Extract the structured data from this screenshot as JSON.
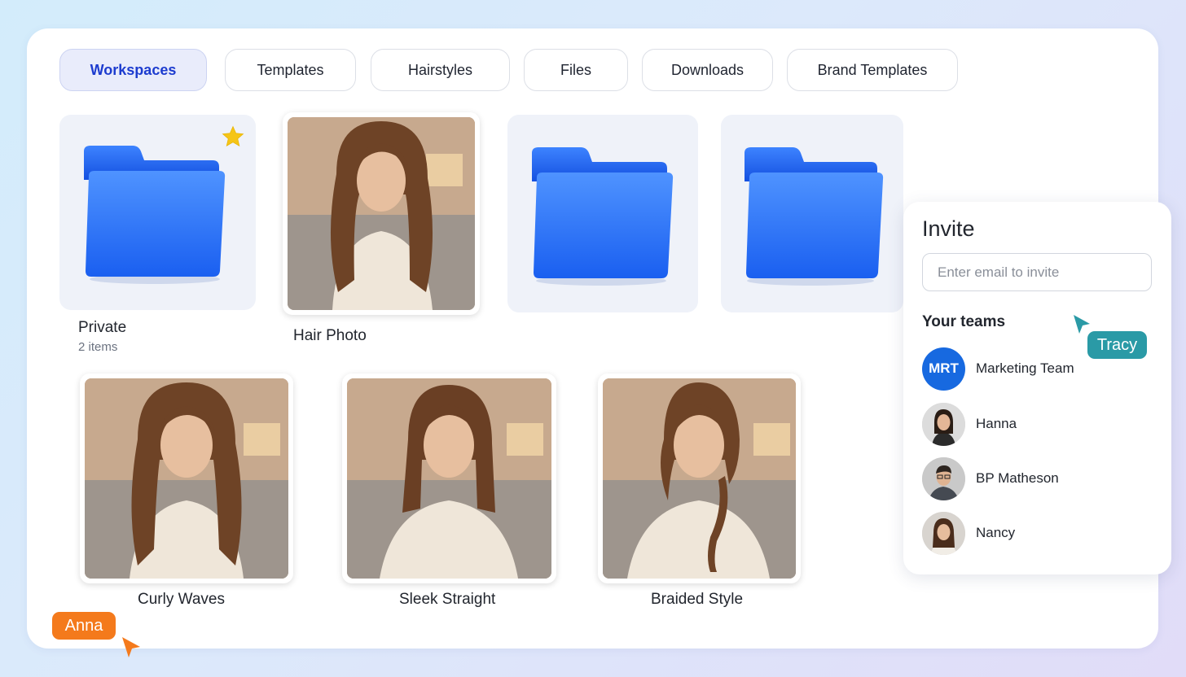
{
  "tabs": [
    {
      "label": "Workspaces",
      "active": true
    },
    {
      "label": "Templates",
      "active": false
    },
    {
      "label": "Hairstyles",
      "active": false
    },
    {
      "label": "Files",
      "active": false
    },
    {
      "label": "Downloads",
      "active": false
    },
    {
      "label": "Brand Templates",
      "active": false
    }
  ],
  "items": {
    "private": {
      "name": "Private",
      "count": "2 items",
      "icon": "folder-icon",
      "starred": true
    },
    "hair_photo": {
      "name": "Hair Photo"
    },
    "folder_2": {
      "icon": "folder-icon"
    },
    "folder_3": {
      "icon": "folder-icon"
    },
    "curly": {
      "name": "Curly Waves"
    },
    "sleek": {
      "name": "Sleek Straight"
    },
    "braided": {
      "name": "Braided Style"
    }
  },
  "invite": {
    "title": "Invite",
    "placeholder": "Enter email to invite",
    "teams_heading": "Your teams",
    "teams": [
      {
        "initials": "MRT",
        "name": "Marketing Team"
      },
      {
        "initials": "",
        "name": "Hanna"
      },
      {
        "initials": "",
        "name": "BP Matheson"
      },
      {
        "initials": "",
        "name": "Nancy"
      }
    ]
  },
  "cursors": [
    {
      "name": "Tracy",
      "color": "#2a9aa6"
    },
    {
      "name": "Anna",
      "color": "#f47a1c"
    }
  ],
  "colors": {
    "accent": "#1d3ccf",
    "folder": "#1f66f0",
    "star": "#f5c518"
  }
}
